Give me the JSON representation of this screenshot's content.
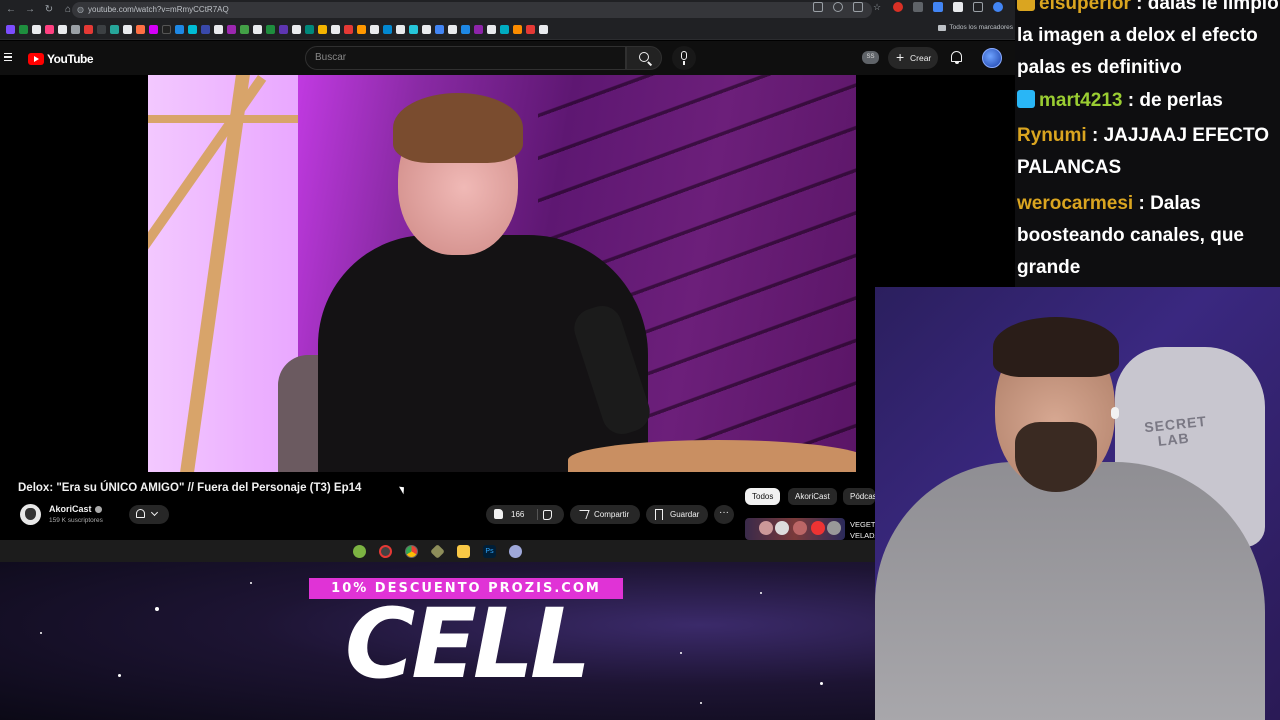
{
  "browser": {
    "url": "youtube.com/watch?v=mRmyCCtR7AQ",
    "bookmarks_folder": "Todos los marcadores"
  },
  "youtube": {
    "logo_text": "YouTube",
    "search_placeholder": "Buscar",
    "ss_badge": "SS",
    "create_label": "Crear"
  },
  "video": {
    "title": "Delox: \"Era su ÚNICO AMIGO\" // Fuera del Personaje (T3) Ep14",
    "channel_name": "AkoriCast",
    "subscribers": "159 K suscriptores",
    "likes": "166",
    "share_label": "Compartir",
    "save_label": "Guardar",
    "more_label": "···"
  },
  "chips": [
    "Todos",
    "AkoriCast",
    "Pódcasts"
  ],
  "related": {
    "text_line1": "VEGETTA",
    "text_line2": "VELADA"
  },
  "overlay": {
    "promo": "10% DESCUENTO PROZIS.COM",
    "brand": "CELL"
  },
  "chat": {
    "messages": [
      {
        "user": "elsuperior",
        "text": ": dalas le limpio la imagen a delox el efecto palas es definitivo"
      },
      {
        "user": "mart4213",
        "text": ": de perlas"
      },
      {
        "user": "Rynumi",
        "text": ": JAJJAAJ EFECTO PALANCAS"
      },
      {
        "user": "werocarmesi",
        "text": ": Dalas boosteando canales, que grande"
      }
    ]
  },
  "webcam": {
    "chair_brand_line1": "SECRET",
    "chair_brand_line2": "LAB"
  },
  "colors": {
    "youtube_red": "#ff0000",
    "promo_magenta": "#e033d6",
    "chat_user_gold": "#daa520",
    "chat_user_green": "#9acd32"
  }
}
